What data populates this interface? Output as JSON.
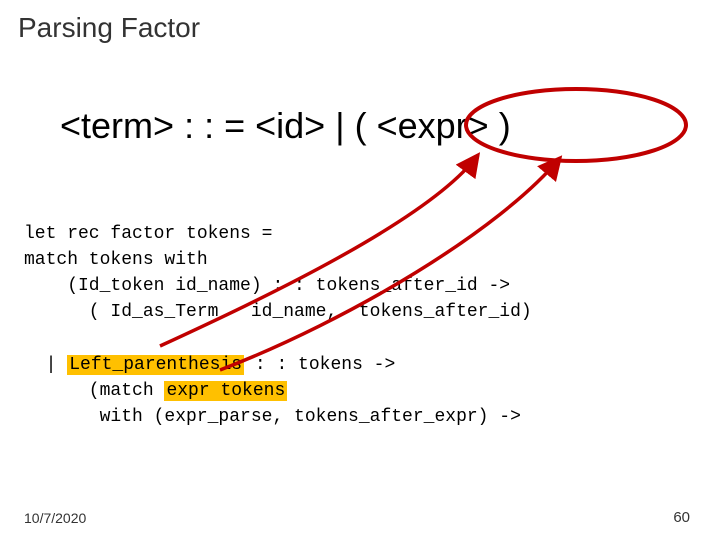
{
  "title": "Parsing Factor",
  "grammar": {
    "lhs": "<term>",
    "op": ": : =",
    "id": "<id>",
    "pipe": "|",
    "lp": "(",
    "expr": "<expr>",
    "rp": ")"
  },
  "code": {
    "l1": "let rec factor tokens =",
    "l2": "match tokens with",
    "l3": "    (Id_token id_name) : : tokens_after_id ->",
    "l4": "      ( Id_as_Term   id_name,  tokens_after_id)",
    "l5a": "  | ",
    "l5h": "Left_parenthesis",
    "l5b": " : : tokens ->",
    "l6a": "      (match ",
    "l6h": "expr tokens",
    "l7": "       with (expr_parse, tokens_after_expr) ->"
  },
  "footer": {
    "date": "10/7/2020",
    "page": "60"
  }
}
